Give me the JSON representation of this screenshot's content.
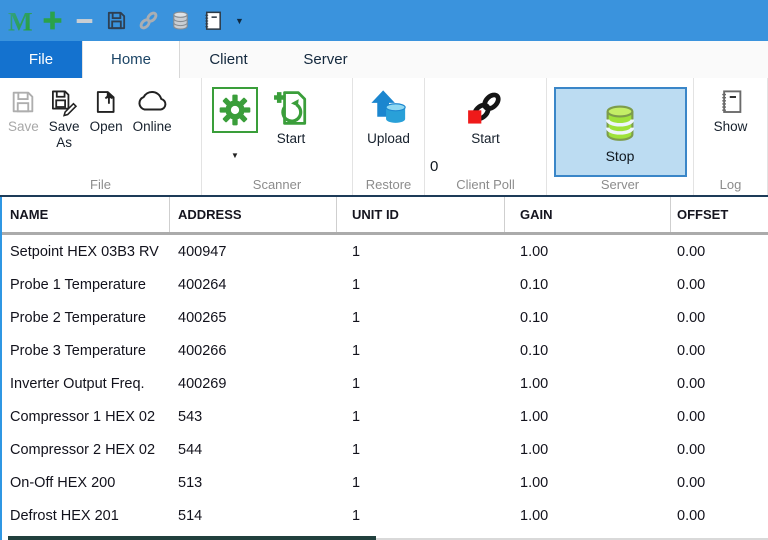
{
  "titlebar": {
    "logo": "M"
  },
  "tabs": {
    "file": "File",
    "home": "Home",
    "client": "Client",
    "server": "Server"
  },
  "ribbon": {
    "file_group": {
      "label": "File",
      "save": "Save",
      "save_as_line1": "Save",
      "save_as_line2": "As",
      "open": "Open",
      "online": "Online"
    },
    "scanner_group": {
      "label": "Scanner",
      "start": "Start"
    },
    "restore_group": {
      "label": "Restore",
      "upload": "Upload",
      "counter": "0"
    },
    "client_poll_group": {
      "label": "Client Poll",
      "start": "Start"
    },
    "server_group": {
      "label": "Server",
      "stop": "Stop"
    },
    "log_group": {
      "label": "Log",
      "show": "Show"
    }
  },
  "table": {
    "headers": {
      "name": "NAME",
      "address": "ADDRESS",
      "unit_id": "UNIT ID",
      "gain": "GAIN",
      "offset": "OFFSET"
    },
    "rows": [
      {
        "name": "Setpoint HEX 03B3 RV",
        "address": "400947",
        "unit_id": "1",
        "gain": "1.00",
        "offset": "0.00"
      },
      {
        "name": "Probe 1 Temperature",
        "address": "400264",
        "unit_id": "1",
        "gain": "0.10",
        "offset": "0.00"
      },
      {
        "name": "Probe 2 Temperature",
        "address": "400265",
        "unit_id": "1",
        "gain": "0.10",
        "offset": "0.00"
      },
      {
        "name": "Probe 3 Temperature",
        "address": "400266",
        "unit_id": "1",
        "gain": "0.10",
        "offset": "0.00"
      },
      {
        "name": "Inverter Output Freq.",
        "address": "400269",
        "unit_id": "1",
        "gain": "1.00",
        "offset": "0.00"
      },
      {
        "name": "Compressor 1  HEX 02",
        "address": "543",
        "unit_id": "1",
        "gain": "1.00",
        "offset": "0.00"
      },
      {
        "name": "Compressor 2 HEX 02",
        "address": "544",
        "unit_id": "1",
        "gain": "1.00",
        "offset": "0.00"
      },
      {
        "name": "On-Off HEX 200",
        "address": "513",
        "unit_id": "1",
        "gain": "1.00",
        "offset": "0.00"
      },
      {
        "name": "Defrost HEX 201",
        "address": "514",
        "unit_id": "1",
        "gain": "1.00",
        "offset": "0.00"
      }
    ]
  },
  "colors": {
    "titlebar_blue": "#3a93dd",
    "file_tab_blue": "#1472cf",
    "ribbon_green": "#3a9e3a",
    "server_lime": "#9fe23a",
    "stop_square_red": "#ef1a1a",
    "upload_blue": "#1b86cf",
    "server_button_bg": "#bcdcf2",
    "server_button_border": "#3a86c8",
    "ribbon_divider_dark": "#1d3b58",
    "table_left_border": "#2f97e3"
  }
}
